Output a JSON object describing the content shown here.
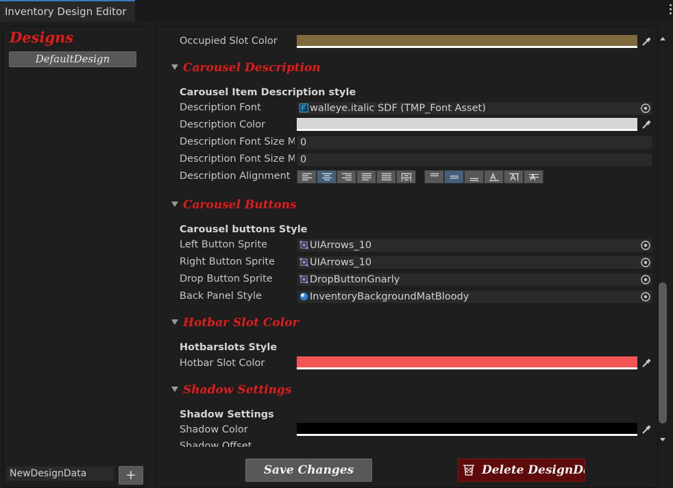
{
  "window": {
    "tab_title": "Inventory Design Editor"
  },
  "left_panel": {
    "title": "Designs",
    "items": [
      "DefaultDesign"
    ],
    "new_design_value": "NewDesignData",
    "add_label": "+"
  },
  "inspector": {
    "occupied_slot": {
      "label": "Occupied Slot Color",
      "color": "#7e6a3c"
    },
    "carousel_description": {
      "section": "Carousel Description",
      "style_header": "Carousel Item Description style",
      "font_label": "Description Font",
      "font_value": "walleye.italic SDF (TMP_Font Asset)",
      "color_label": "Description Color",
      "color": "#d6d6d6",
      "size_min_label": "Description Font Size Min",
      "size_min_value": "0",
      "size_max_label": "Description Font Size Max",
      "size_max_value": "0",
      "alignment_label": "Description Alignment"
    },
    "carousel_buttons": {
      "section": "Carousel Buttons",
      "style_header": "Carousel buttons Style",
      "left_label": "Left Button Sprite",
      "left_value": "UIArrows_10",
      "right_label": "Right Button Sprite",
      "right_value": "UIArrows_10",
      "drop_label": "Drop Button Sprite",
      "drop_value": "DropButtonGnarly",
      "panel_label": "Back Panel Style",
      "panel_value": "InventoryBackgroundMatBloody"
    },
    "hotbar": {
      "section": "Hotbar Slot Color",
      "style_header": "Hotbarslots Style",
      "color_label": "Hotbar Slot Color",
      "color": "#f55454"
    },
    "shadow": {
      "section": "Shadow Settings",
      "style_header": "Shadow Settings",
      "color_label": "Shadow Color",
      "color": "#000000",
      "offset_label": "Shadow Offset"
    }
  },
  "footer": {
    "save_label": "Save Changes",
    "delete_label": "Delete DesignData"
  }
}
